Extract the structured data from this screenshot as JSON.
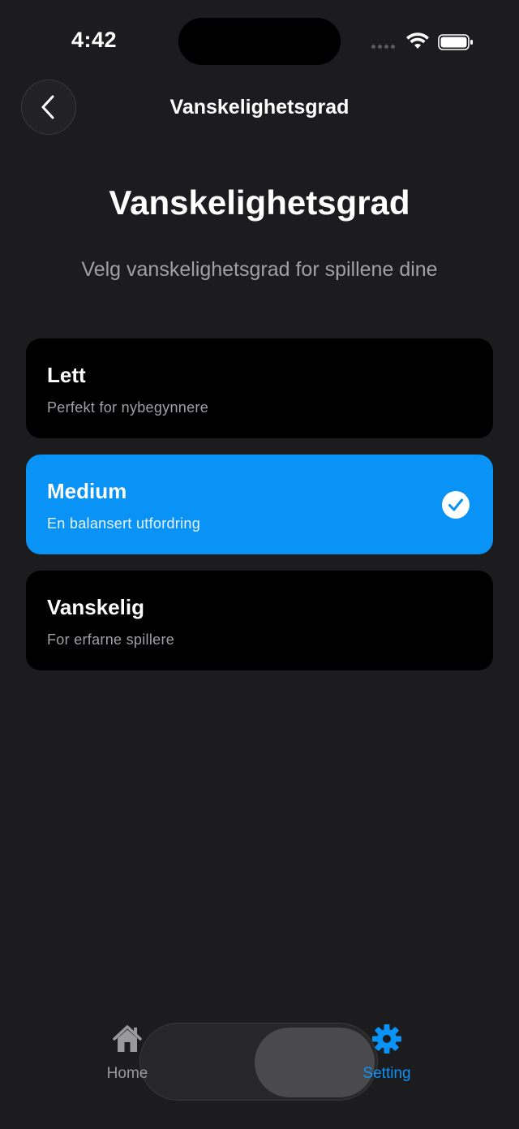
{
  "status_bar": {
    "time": "4:42"
  },
  "nav": {
    "title": "Vanskelighetsgrad"
  },
  "page": {
    "title": "Vanskelighetsgrad",
    "subtitle": "Velg vanskelighetsgrad for spillene dine"
  },
  "options": [
    {
      "title": "Lett",
      "description": "Perfekt for nybegynnere",
      "selected": false
    },
    {
      "title": "Medium",
      "description": "En balansert utfordring",
      "selected": true
    },
    {
      "title": "Vanskelig",
      "description": "For erfarne spillere",
      "selected": false
    }
  ],
  "tab_bar": {
    "home_label": "Home",
    "setting_label": "Setting",
    "active": "Setting"
  },
  "colors": {
    "background": "#1c1c1e",
    "card": "#000000",
    "accent": "#0a93f7",
    "secondary_text": "#a0a0a5"
  },
  "icons": {
    "back": "chevron-left-icon",
    "check": "checkmark-circle-icon",
    "home": "house-icon",
    "setting": "gear-icon"
  }
}
